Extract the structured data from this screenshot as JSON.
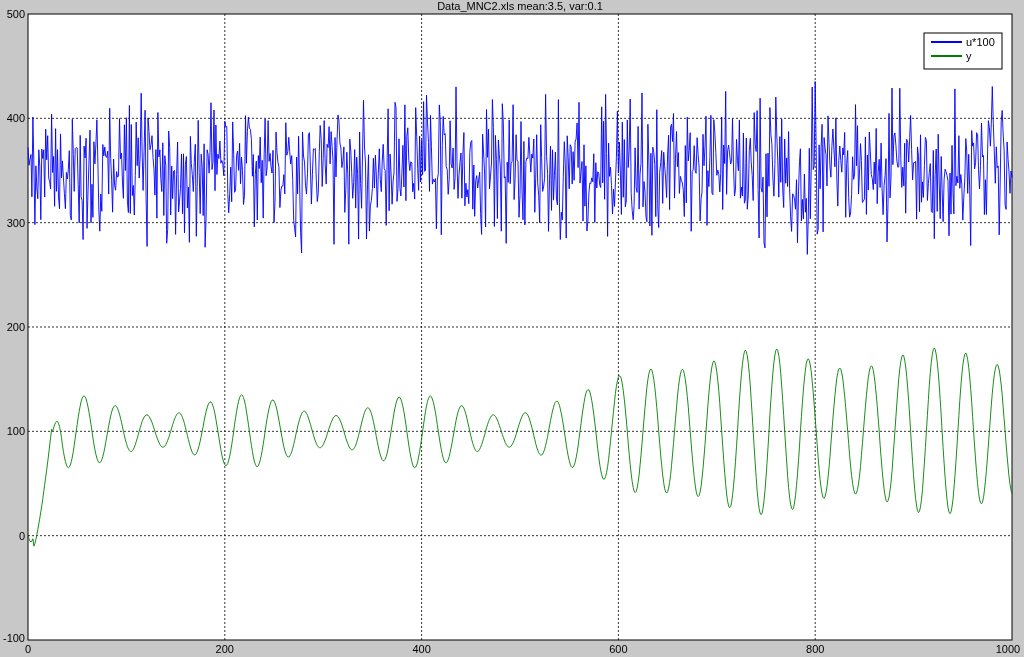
{
  "title": "Data_MNC2.xls mean:3.5, var:0.1",
  "yticks": [
    "500",
    "400",
    "300",
    "200",
    "100",
    "0",
    "-100"
  ],
  "xticks": [
    "0",
    "200",
    "400",
    "600",
    "800",
    "1000"
  ],
  "legend": [
    {
      "label": "u*100",
      "color": "#0000ff"
    },
    {
      "label": "y",
      "color": "#008000"
    }
  ]
}
